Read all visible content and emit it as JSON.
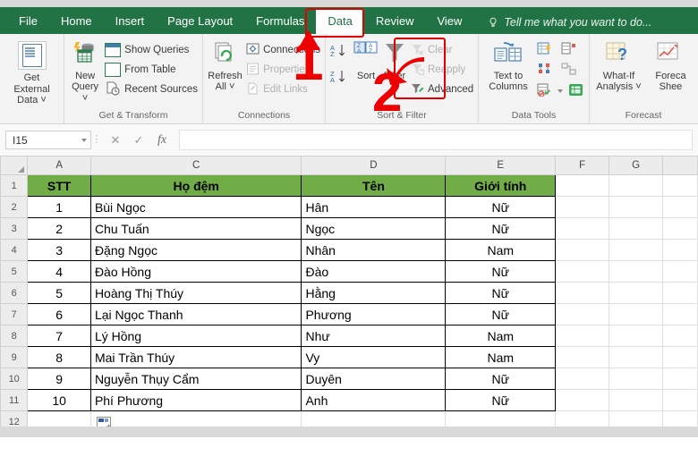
{
  "ribbon": {
    "tabs": [
      {
        "label": "File",
        "active": false
      },
      {
        "label": "Home",
        "active": false
      },
      {
        "label": "Insert",
        "active": false
      },
      {
        "label": "Page Layout",
        "active": false
      },
      {
        "label": "Formulas",
        "active": false
      },
      {
        "label": "Data",
        "active": true
      },
      {
        "label": "Review",
        "active": false
      },
      {
        "label": "View",
        "active": false
      }
    ],
    "tellme": "Tell me what you want to do...",
    "groups": {
      "get_external": {
        "title": "",
        "button": "Get External\nData",
        "label_line1": "Get External",
        "label_line2": "Data ˅"
      },
      "get_transform": {
        "title": "Get & Transform",
        "new_query_line1": "New",
        "new_query_line2": "Query ˅",
        "items": [
          "Show Queries",
          "From Table",
          "Recent Sources"
        ]
      },
      "connections": {
        "title": "Connections",
        "refresh_line1": "Refresh",
        "refresh_line2": "All ˅",
        "items": [
          "Connections",
          "Properties",
          "Edit Links"
        ]
      },
      "sort_filter": {
        "title": "Sort & Filter",
        "sort_label": "Sort",
        "filter_label": "Filter",
        "items": [
          "Clear",
          "Reapply",
          "Advanced"
        ]
      },
      "data_tools": {
        "title": "Data Tools",
        "text_to_columns_line1": "Text to",
        "text_to_columns_line2": "Columns"
      },
      "forecast": {
        "title": "Forecast",
        "what_if_line1": "What-If",
        "what_if_line2": "Analysis ˅",
        "forecast_sheet_line1": "Foreca",
        "forecast_sheet_line2": "Shee"
      }
    }
  },
  "annotations": [
    {
      "name": "step-1",
      "label": "1"
    },
    {
      "name": "step-2",
      "label": "2"
    }
  ],
  "formula_bar": {
    "name_box": "I15",
    "cancel_icon": "✕",
    "confirm_icon": "✓",
    "function_icon": "fx",
    "formula_value": ""
  },
  "sheet": {
    "columns": [
      "A",
      "C",
      "D",
      "E",
      "F",
      "G"
    ],
    "row_numbers": [
      "1",
      "2",
      "3",
      "4",
      "5",
      "6",
      "7",
      "8",
      "9",
      "10",
      "11",
      "12"
    ],
    "header_color": "#71ad47",
    "header_row": [
      "STT",
      "Họ đệm",
      "Tên",
      "Giới tính"
    ],
    "rows": [
      {
        "stt": "1",
        "ho_dem": "Bùi Ngọc",
        "ten": "Hân",
        "gioi_tinh": "Nữ"
      },
      {
        "stt": "2",
        "ho_dem": "Chu Tuấn",
        "ten": "Ngọc",
        "gioi_tinh": "Nữ"
      },
      {
        "stt": "3",
        "ho_dem": "Đặng Ngọc",
        "ten": "Nhân",
        "gioi_tinh": "Nam"
      },
      {
        "stt": "4",
        "ho_dem": "Đào Hồng",
        "ten": "Đào",
        "gioi_tinh": "Nữ"
      },
      {
        "stt": "5",
        "ho_dem": "Hoàng Thị Thúy",
        "ten": "Hằng",
        "gioi_tinh": "Nữ"
      },
      {
        "stt": "6",
        "ho_dem": "Lại Ngọc Thanh",
        "ten": "Phương",
        "gioi_tinh": "Nữ"
      },
      {
        "stt": "7",
        "ho_dem": "Lý Hồng",
        "ten": "Như",
        "gioi_tinh": "Nam"
      },
      {
        "stt": "8",
        "ho_dem": "Mai Trần Thúy",
        "ten": "Vy",
        "gioi_tinh": "Nam"
      },
      {
        "stt": "9",
        "ho_dem": "Nguyễn Thụy Cẩm",
        "ten": "Duyên",
        "gioi_tinh": "Nữ"
      },
      {
        "stt": "10",
        "ho_dem": "Phí Phương",
        "ten": "Anh",
        "gioi_tinh": "Nữ"
      }
    ]
  }
}
